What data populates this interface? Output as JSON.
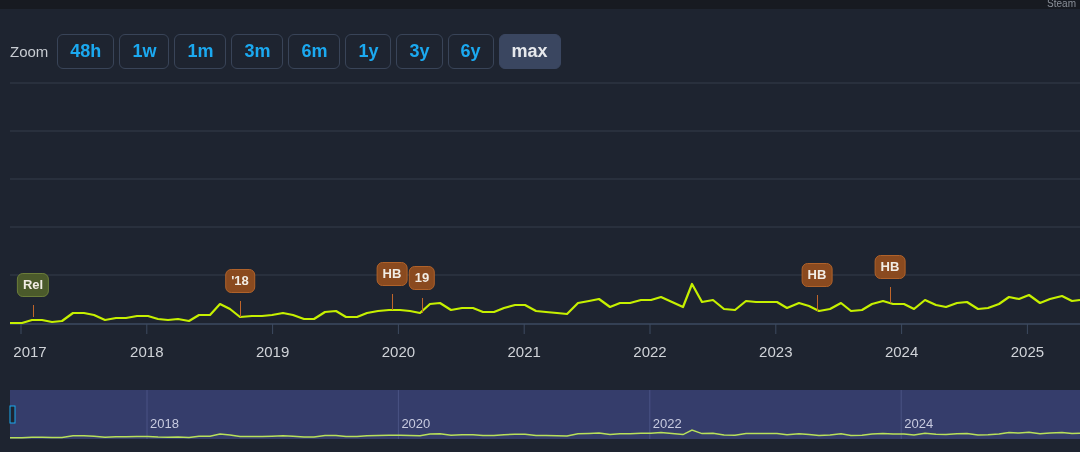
{
  "header": {
    "text": "Steam"
  },
  "zoom": {
    "label": "Zoom",
    "buttons": [
      {
        "label": "48h",
        "selected": false
      },
      {
        "label": "1w",
        "selected": false
      },
      {
        "label": "1m",
        "selected": false
      },
      {
        "label": "3m",
        "selected": false
      },
      {
        "label": "6m",
        "selected": false
      },
      {
        "label": "1y",
        "selected": false
      },
      {
        "label": "3y",
        "selected": false
      },
      {
        "label": "6y",
        "selected": false
      },
      {
        "label": "max",
        "selected": true
      }
    ]
  },
  "chart": {
    "flags": [
      {
        "text": "Rel",
        "kind": "release"
      },
      {
        "text": "'18",
        "kind": "sale"
      },
      {
        "text": "HB",
        "kind": "sale"
      },
      {
        "text": "19",
        "kind": "sale"
      },
      {
        "text": "HB",
        "kind": "sale"
      },
      {
        "text": "HB",
        "kind": "sale"
      }
    ],
    "x_labels": [
      "2017",
      "2018",
      "2019",
      "2020",
      "2021",
      "2022",
      "2023",
      "2024",
      "2025"
    ]
  },
  "navigator": {
    "labels": [
      "2018",
      "2020",
      "2022",
      "2024"
    ]
  }
}
